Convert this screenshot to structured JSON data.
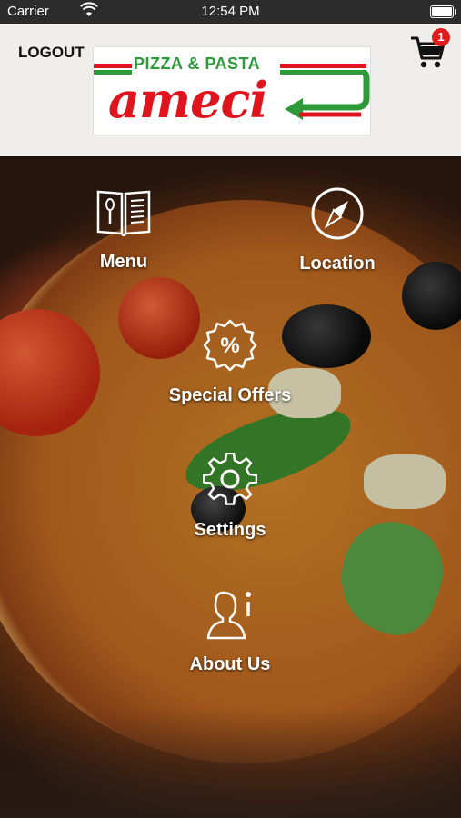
{
  "status": {
    "carrier": "Carrier",
    "time": "12:54 PM"
  },
  "header": {
    "logout_label": "LOGOUT",
    "logo": {
      "tagline": "PIZZA & PASTA",
      "brand": "ameci"
    },
    "cart": {
      "count": "1"
    }
  },
  "tiles": {
    "menu": "Menu",
    "location": "Location",
    "offers": "Special Offers",
    "settings": "Settings",
    "about": "About Us"
  },
  "icons": {
    "menu": "menu-book-icon",
    "location": "compass-icon",
    "offers": "percent-badge-icon",
    "settings": "gear-icon",
    "about": "user-info-icon",
    "cart": "shopping-cart-icon"
  },
  "colors": {
    "brand_red": "#e0141c",
    "brand_green": "#2e9a3a",
    "badge": "#e01c1c"
  }
}
